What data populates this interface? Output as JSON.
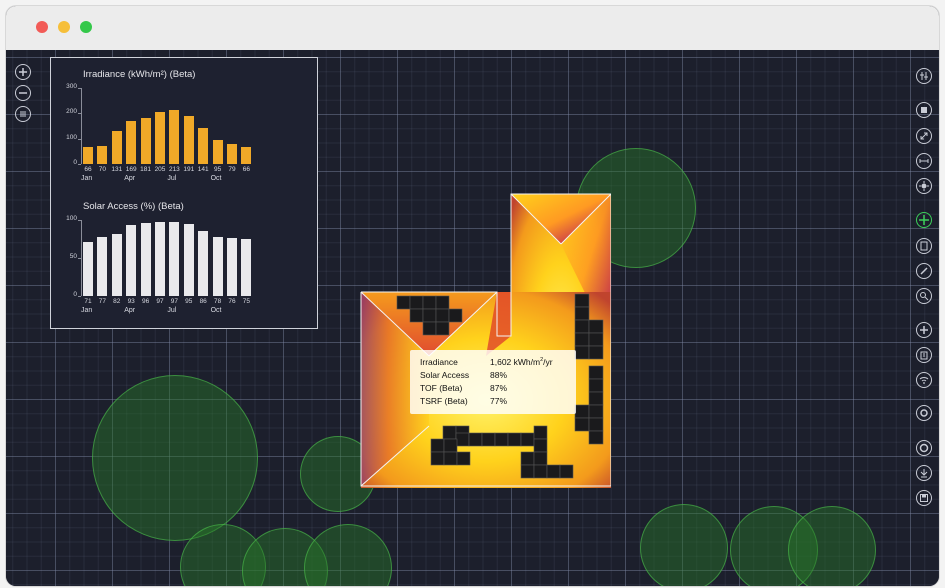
{
  "colors": {
    "irradiance_bar": "#f0a928",
    "solar_access_bar": "#e9e9ec",
    "selected_tool": "#3ccf5a",
    "tree": "#2a8a2a",
    "canvas": "#1c1f2c"
  },
  "toolbar_left": [
    {
      "icon": "zoom-in-icon"
    },
    {
      "icon": "zoom-out-icon"
    },
    {
      "icon": "layers-icon"
    }
  ],
  "toolbar_right": [
    {
      "icon": "settings-sliders-icon"
    },
    {
      "icon": "stop-icon"
    },
    {
      "icon": "resize-icon"
    },
    {
      "icon": "measure-icon"
    },
    {
      "icon": "sun-icon"
    },
    {
      "icon": "move-icon",
      "selected": true
    },
    {
      "icon": "panel-icon"
    },
    {
      "icon": "pencil-icon"
    },
    {
      "icon": "search-icon"
    },
    {
      "icon": "add-icon"
    },
    {
      "icon": "building-icon"
    },
    {
      "icon": "wifi-icon"
    },
    {
      "icon": "gear-icon"
    },
    {
      "icon": "circle-icon"
    },
    {
      "icon": "download-icon"
    },
    {
      "icon": "save-icon"
    }
  ],
  "chart_data": [
    {
      "type": "bar",
      "title": "Irradiance (kWh/m²) (Beta)",
      "categories": [
        "Jan",
        "Feb",
        "Mar",
        "Apr",
        "May",
        "Jun",
        "Jul",
        "Aug",
        "Sep",
        "Oct",
        "Nov",
        "Dec"
      ],
      "values": [
        66,
        70,
        131,
        169,
        181,
        205,
        213,
        191,
        141,
        95,
        79,
        66
      ],
      "value_labels": [
        "66",
        "70",
        "131",
        "169",
        "181",
        "205",
        "213",
        "191",
        "141",
        "95",
        "79",
        "66"
      ],
      "ylim": [
        0,
        300
      ],
      "yticks": [
        "300",
        "200",
        "100",
        "0"
      ],
      "ytick_values": [
        300,
        200,
        100,
        0
      ],
      "x_tick_labels": [
        {
          "label": "Jan",
          "index": 0
        },
        {
          "label": "Apr",
          "index": 3
        },
        {
          "label": "Jul",
          "index": 6
        },
        {
          "label": "Oct",
          "index": 9
        }
      ],
      "color": "#f0a928"
    },
    {
      "type": "bar",
      "title": "Solar Access (%) (Beta)",
      "categories": [
        "Jan",
        "Feb",
        "Mar",
        "Apr",
        "May",
        "Jun",
        "Jul",
        "Aug",
        "Sep",
        "Oct",
        "Nov",
        "Dec"
      ],
      "values": [
        71,
        77,
        82,
        93,
        96,
        97,
        97,
        95,
        86,
        78,
        76,
        75
      ],
      "value_labels": [
        "71",
        "77",
        "82",
        "93",
        "96",
        "97",
        "97",
        "95",
        "86",
        "78",
        "76",
        "75"
      ],
      "ylim": [
        0,
        100
      ],
      "yticks": [
        "100",
        "50",
        "0"
      ],
      "ytick_values": [
        100,
        50,
        0
      ],
      "x_tick_labels": [
        {
          "label": "Jan",
          "index": 0
        },
        {
          "label": "Apr",
          "index": 3
        },
        {
          "label": "Jul",
          "index": 6
        },
        {
          "label": "Oct",
          "index": 9
        }
      ],
      "color": "#e9e9ec"
    }
  ],
  "tooltip": {
    "irradiance_label": "Irradiance",
    "irradiance_value": "1,602 kWh/m",
    "irradiance_sup": "2",
    "irradiance_unit": "/yr",
    "solar_access_label": "Solar Access",
    "solar_access_value": "88%",
    "tof_label": "TOF (Beta)",
    "tof_value": "87%",
    "tsrf_label": "TSRF (Beta)",
    "tsrf_value": "77%"
  }
}
